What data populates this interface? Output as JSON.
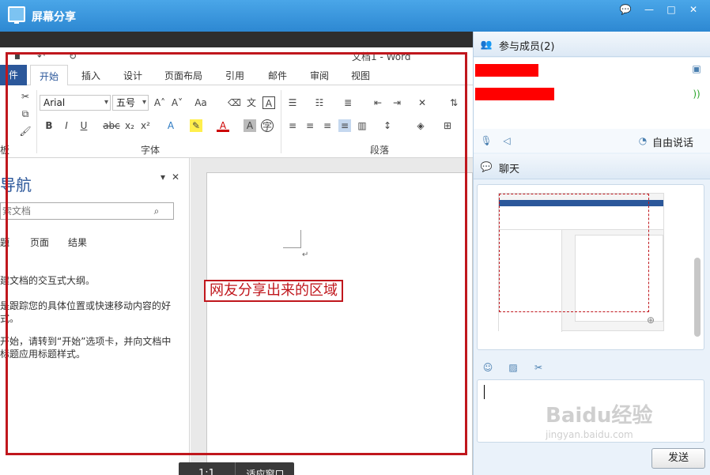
{
  "window": {
    "title": "屏幕分享",
    "buttons": [
      "💬",
      "—",
      "□",
      "✕"
    ]
  },
  "word": {
    "doc_title": "文档1 - Word",
    "tabs": [
      "件",
      "开始",
      "插入",
      "设计",
      "页面布局",
      "引用",
      "邮件",
      "审阅",
      "视图"
    ],
    "font_name": "Arial",
    "font_size": "五号",
    "groups": [
      "板",
      "字体",
      "段落"
    ],
    "nav": {
      "title": "导航",
      "search_placeholder": "索文档",
      "tabs": [
        "题",
        "页面",
        "结果"
      ],
      "lines": [
        "建文档的交互式大纲。",
        "是跟踪您的具体位置或快速移动内容的好",
        "式。",
        "开始，请转到“开始”选项卡，并向文档中",
        "标题应用标题样式。"
      ]
    }
  },
  "share_label": "网友分享出来的区域",
  "zoom": {
    "one_to_one": "1:1",
    "fit": "适应窗口"
  },
  "right": {
    "members_title": "参与成员(2)",
    "voice_label": "自由说话",
    "chat_title": "聊天",
    "send_label": "发送"
  },
  "watermark": {
    "brand": "Baidu经验",
    "url": "jingyan.baidu.com"
  }
}
